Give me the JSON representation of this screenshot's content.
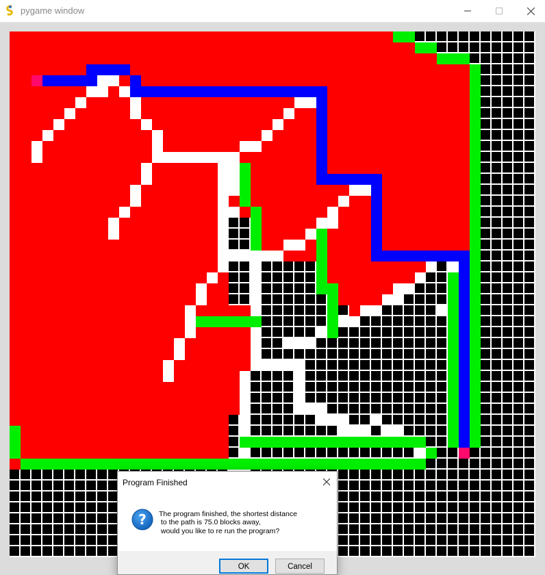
{
  "window": {
    "title": "pygame window"
  },
  "grid": {
    "cols": 48,
    "rows": 48,
    "colors": {
      "black": "#000000",
      "white": "#ffffff",
      "red": "#ff0000",
      "green": "#00ee00",
      "blue": "#0000ff",
      "pink": "#ff0a6c",
      "gridline": "#ffffff"
    }
  },
  "dialog": {
    "title": "Program Finished",
    "message": "The program finished, the shortest distance\n to the path is 75.0 blocks away,\n would you like to re run the program?",
    "ok_label": "OK",
    "cancel_label": "Cancel",
    "icon": "question-icon"
  }
}
